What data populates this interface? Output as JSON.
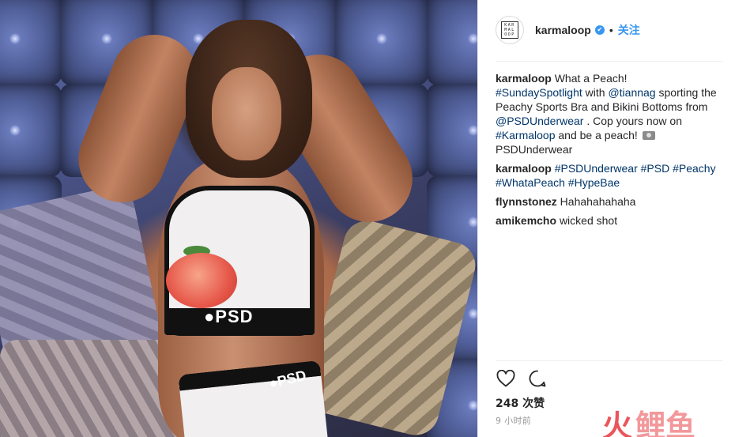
{
  "post": {
    "username": "karmaloop",
    "verified_badge": "✔",
    "separator": "•",
    "follow_label": "关注",
    "avatar_text": "KAR MAL OOP"
  },
  "caption": {
    "user": "karmaloop",
    "t1": "What a Peach!",
    "tag1": "#SundaySpotlight",
    "t2": "with",
    "tag2": "@tiannag",
    "t3": "sporting the Peachy Sports Bra and Bikini Bottoms from",
    "tag3": "@PSDUnderwear",
    "t4": ". Cop yours now on",
    "tag4": "#Karmaloop",
    "t5": "and be a peach!",
    "t6": "PSDUnderwear"
  },
  "comments": [
    {
      "user": "karmaloop",
      "tags": "#PSDUnderwear #PSD #Peachy #WhataPeach #HypeBae"
    },
    {
      "user": "flynnstonez",
      "text": "Hahahahahaha"
    },
    {
      "user": "amikemcho",
      "text": "wicked shot"
    }
  ],
  "stats": {
    "likes": "248 次赞",
    "time": "9 小时前"
  },
  "photo": {
    "bra_logo": "●PSD",
    "bottom_logo": "●PSD"
  },
  "watermark": {
    "part1": "火",
    "part2": "鲤鱼"
  },
  "colors": {
    "link": "#003569",
    "accent": "#3897f0",
    "watermark": "#e8444b"
  }
}
